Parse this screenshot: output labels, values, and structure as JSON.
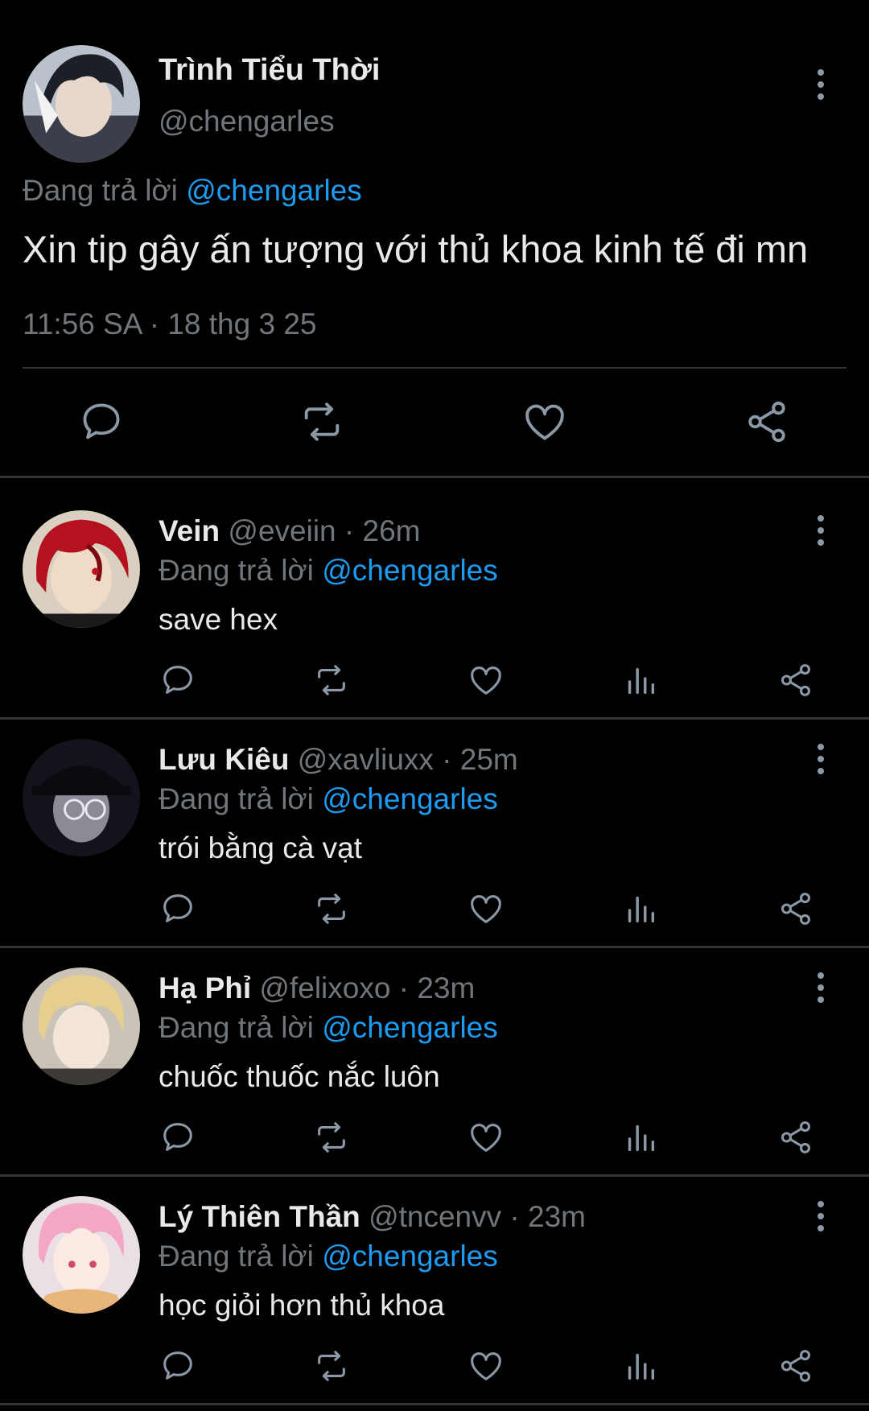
{
  "main_tweet": {
    "display_name": "Trình Tiểu Thời",
    "handle": "@chengarles",
    "replying_prefix": "Đang trả lời",
    "replying_to": "@chengarles",
    "text": "Xin tip gây ấn tượng với thủ khoa kinh tế đi mn",
    "timestamp": "11:56 SA · 18 thg 3 25",
    "actions": [
      "reply-icon",
      "retweet-icon",
      "like-icon",
      "share-icon"
    ]
  },
  "replies": [
    {
      "display_name": "Vein",
      "handle": "@eveiin",
      "time": "· 26m",
      "replying_prefix": "Đang trả lời",
      "replying_to": "@chengarles",
      "text": "save hex"
    },
    {
      "display_name": "Lưu Kiêu",
      "handle": "@xavliuxx",
      "time": "· 25m",
      "replying_prefix": "Đang trả lời",
      "replying_to": "@chengarles",
      "text": "trói bằng cà vạt"
    },
    {
      "display_name": "Hạ Phỉ",
      "handle": "@felixoxo",
      "time": "· 23m",
      "replying_prefix": "Đang trả lời",
      "replying_to": "@chengarles",
      "text": "chuốc thuốc nắc luôn"
    },
    {
      "display_name": "Lý Thiên Thần",
      "handle": "@tncenvv",
      "time": "· 23m",
      "replying_prefix": "Đang trả lời",
      "replying_to": "@chengarles",
      "text": "học giỏi hơn thủ khoa"
    }
  ],
  "reply_actions": [
    "reply-icon",
    "retweet-icon",
    "like-icon",
    "views-icon",
    "share-icon"
  ],
  "colors": {
    "background": "#000000",
    "text": "#e7e9ea",
    "muted": "#71767b",
    "link": "#1d9bf0",
    "divider": "#2f3336"
  }
}
